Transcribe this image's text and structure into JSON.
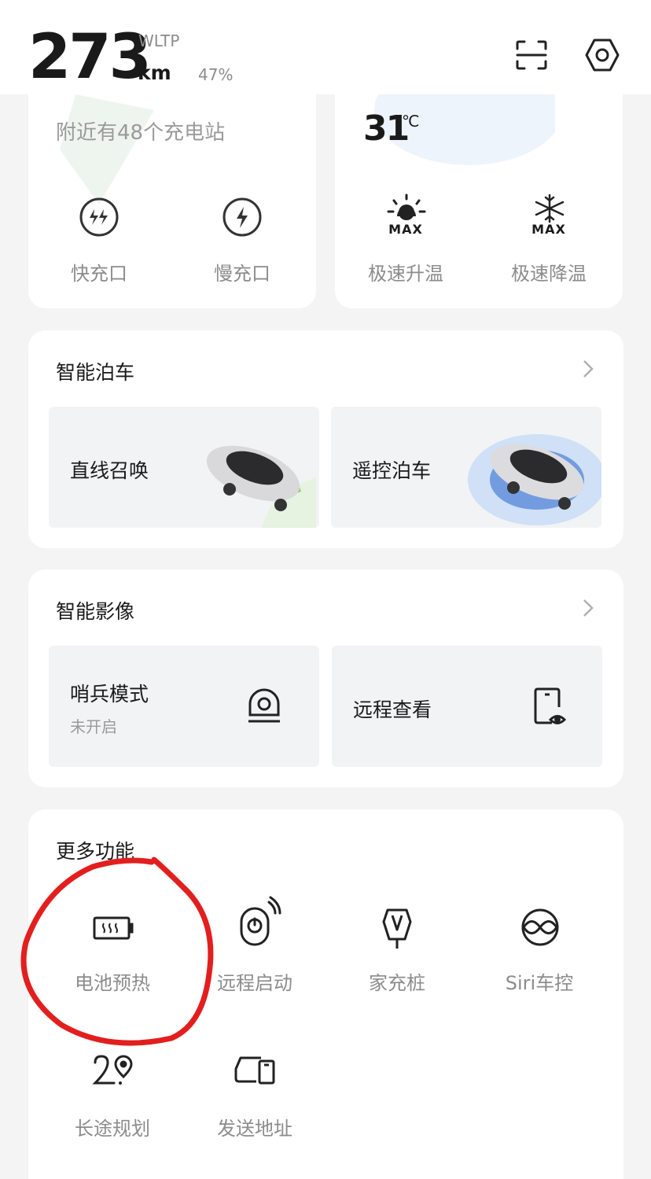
{
  "header": {
    "range_value": "273",
    "range_unit": "km",
    "range_standard": "WLTP",
    "battery_percent": "47%",
    "icons": [
      "scan-icon",
      "settings-icon"
    ]
  },
  "charging_card": {
    "nearby_text": "附近有48个充电站",
    "fast_port_label": "快充口",
    "slow_port_label": "慢充口"
  },
  "climate_card": {
    "temperature": "31",
    "temperature_unit": "℃",
    "heat_label": "极速升温",
    "cool_label": "极速降温",
    "max_text": "MAX"
  },
  "parking": {
    "title": "智能泊车",
    "summon_label": "直线召唤",
    "remote_label": "遥控泊车"
  },
  "video": {
    "title": "智能影像",
    "sentry_label": "哨兵模式",
    "sentry_status": "未开启",
    "remote_view_label": "远程查看"
  },
  "more": {
    "title": "更多功能",
    "items": [
      {
        "label": "电池预热",
        "icon": "battery-heat-icon"
      },
      {
        "label": "远程启动",
        "icon": "remote-start-icon"
      },
      {
        "label": "家充桩",
        "icon": "home-charger-icon"
      },
      {
        "label": "Siri车控",
        "icon": "siri-icon"
      },
      {
        "label": "长途规划",
        "icon": "route-plan-icon"
      },
      {
        "label": "发送地址",
        "icon": "send-address-icon"
      }
    ]
  },
  "annotation_color": "#e31e1e"
}
